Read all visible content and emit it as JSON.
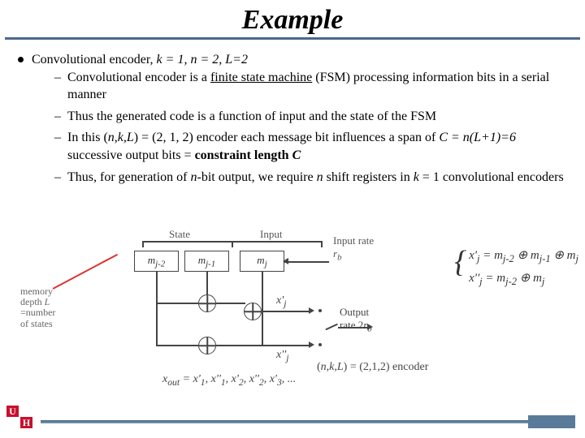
{
  "title": "Example",
  "main_bullet": "Convolutional encoder, ",
  "params": "k = 1, n = 2, L=2",
  "subs": [
    {
      "pre": "Convolutional encoder is a ",
      "u": "finite state machine",
      "post": " (FSM) processing information bits in a serial manner"
    },
    {
      "pre": "Thus the generated code is a function of input and the state of the FSM",
      "u": "",
      "post": ""
    },
    {
      "pre": "In this ",
      "mid": "(n,k,L) = (2, 1, 2) encoder each message bit influences a span of ",
      "c": "C = n(L+1)=6",
      "post2": " successive output bits = ",
      "b": "constraint length ",
      "c2": "C"
    },
    {
      "pre": "Thus, for generation of ",
      "mid2": "n",
      "post": "-bit output, we require ",
      "mid3": "n",
      " post3": " shift registers in ",
      "mid4": "k",
      " post4": " = 1 convolutional encoders"
    }
  ],
  "diagram": {
    "state_label": "State",
    "input_label": "Input",
    "input_rate": "Input rate",
    "rb": "r_b",
    "memory": "memory depth L\n=number\nof states",
    "reg": [
      "m_{j-2}",
      "m_{j-1}",
      "m_j"
    ],
    "x1": "x'_j",
    "x2": "x''_j",
    "output": "Output",
    "output_rate": "rate 2r_b",
    "encoder_label": "(n,k,L) = (2,1,2) encoder",
    "xout": "x_out = x'_1, x''_1, x'_2, x''_2, x'_3, ..."
  },
  "eq": {
    "line1": "x'_j = m_{j-2} ⊕ m_{j-1} ⊕ m_j",
    "line2": "x''_j = m_{j-2} ⊕ m_j"
  }
}
